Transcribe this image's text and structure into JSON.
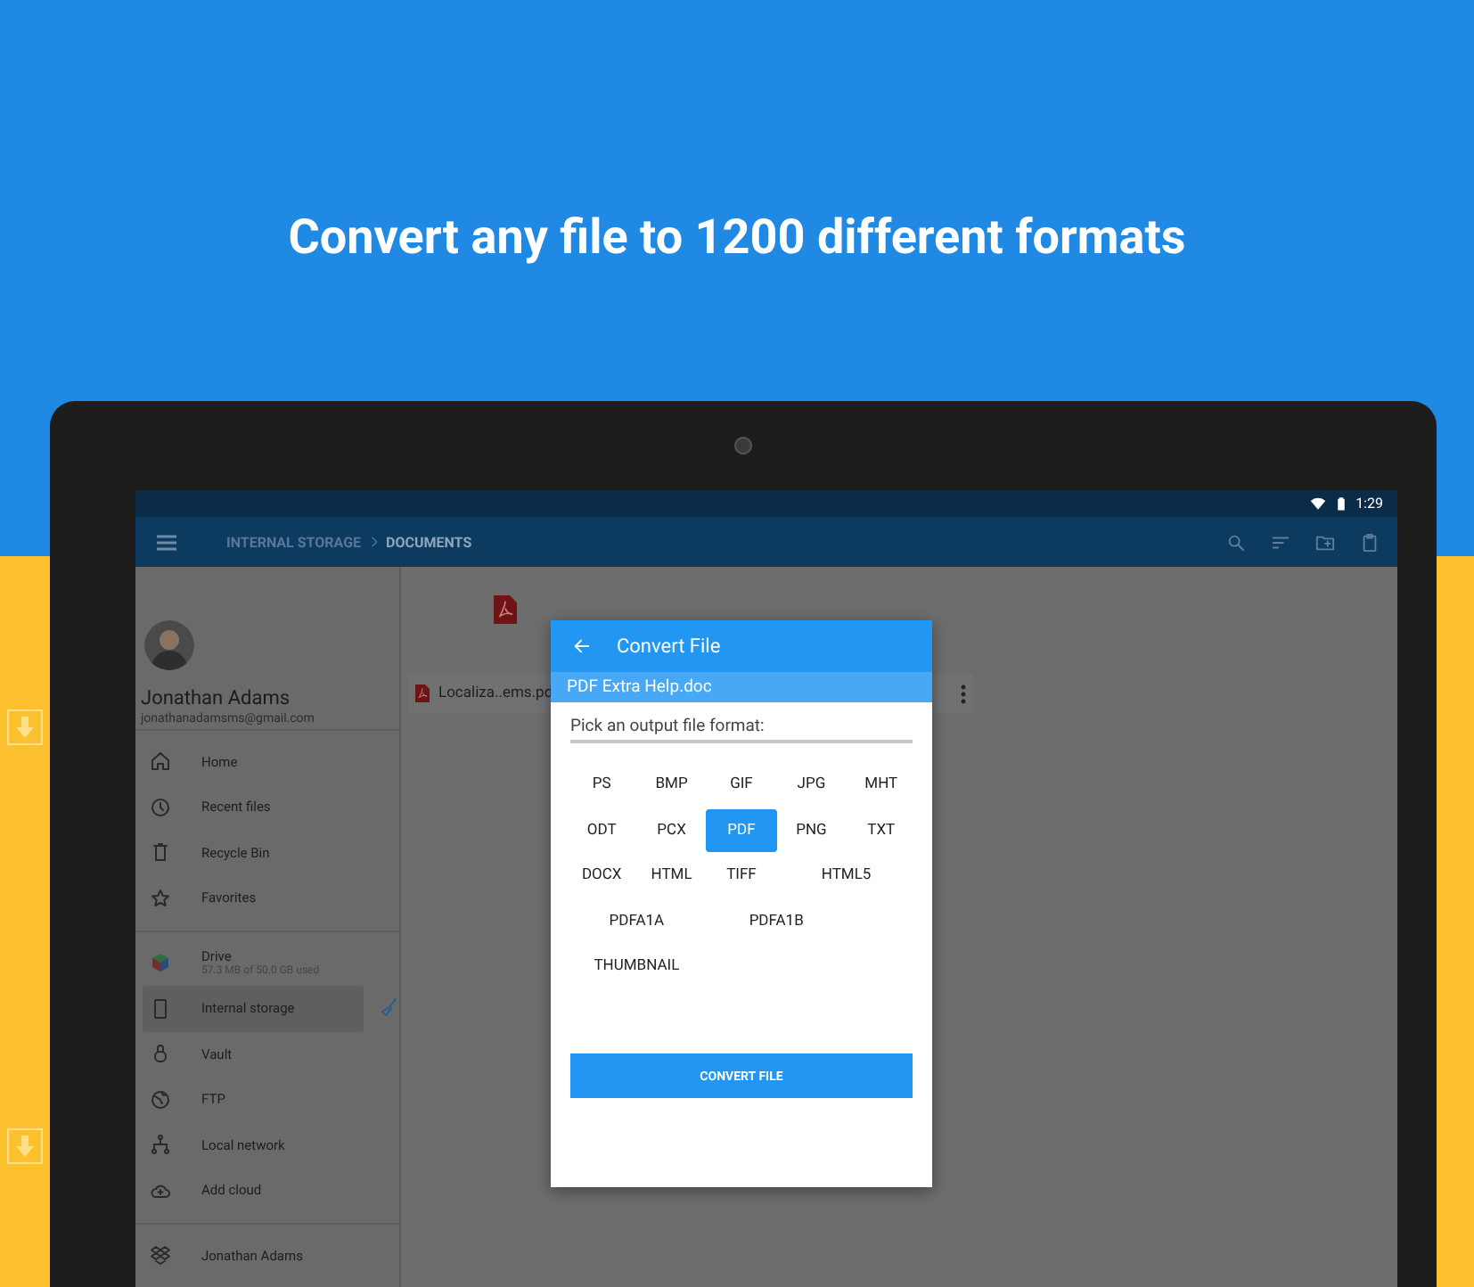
{
  "headline": "Convert any file to 1200 different formats",
  "status_bar": {
    "time": "1:29"
  },
  "app_bar": {
    "breadcrumbs": [
      {
        "label": "INTERNAL STORAGE",
        "selected": false
      },
      {
        "label": "DOCUMENTS",
        "selected": true
      }
    ]
  },
  "sidebar": {
    "account": {
      "name": "Jonathan Adams",
      "email": "jonathanadamsms@gmail.com"
    },
    "sections": [
      [
        {
          "kind": "home",
          "label": "Home",
          "selected": false
        },
        {
          "kind": "clock",
          "label": "Recent files",
          "selected": false
        },
        {
          "kind": "bin",
          "label": "Recycle Bin",
          "selected": false
        },
        {
          "kind": "star",
          "label": "Favorites",
          "selected": false
        }
      ],
      [
        {
          "kind": "drive",
          "label": "Drive",
          "subtitle": "57.3 MB of 50.0 GB used",
          "selected": false
        },
        {
          "kind": "phone",
          "label": "Internal storage",
          "selected": true
        },
        {
          "kind": "lock",
          "label": "Vault",
          "selected": false
        },
        {
          "kind": "globe",
          "label": "FTP",
          "selected": false
        },
        {
          "kind": "network",
          "label": "Local network",
          "selected": false
        },
        {
          "kind": "cloud",
          "label": "Add cloud",
          "selected": false
        }
      ],
      [
        {
          "kind": "dropbox",
          "label": "Jonathan Adams",
          "selected": false
        }
      ]
    ]
  },
  "file_tile": {
    "name": "Localiza..ems.pd"
  },
  "dialog": {
    "title": "Convert File",
    "file_name": "PDF Extra Help.doc",
    "prompt": "Pick an output file format:",
    "formats": [
      {
        "label": "PS",
        "selected": false
      },
      {
        "label": "BMP",
        "selected": false
      },
      {
        "label": "GIF",
        "selected": false
      },
      {
        "label": "JPG",
        "selected": false
      },
      {
        "label": "MHT",
        "selected": false
      },
      {
        "label": "ODT",
        "selected": false
      },
      {
        "label": "PCX",
        "selected": false
      },
      {
        "label": "PDF",
        "selected": true
      },
      {
        "label": "PNG",
        "selected": false
      },
      {
        "label": "TXT",
        "selected": false
      },
      {
        "label": "DOCX",
        "selected": false
      },
      {
        "label": "HTML",
        "selected": false
      },
      {
        "label": "TIFF",
        "selected": false
      },
      {
        "label": "HTML5",
        "selected": false
      },
      {
        "label": "PDFA1A",
        "selected": false
      },
      {
        "label": "PDFA1B",
        "selected": false
      },
      {
        "label": "THUMBNAIL",
        "selected": false
      }
    ],
    "button": "CONVERT FILE"
  }
}
